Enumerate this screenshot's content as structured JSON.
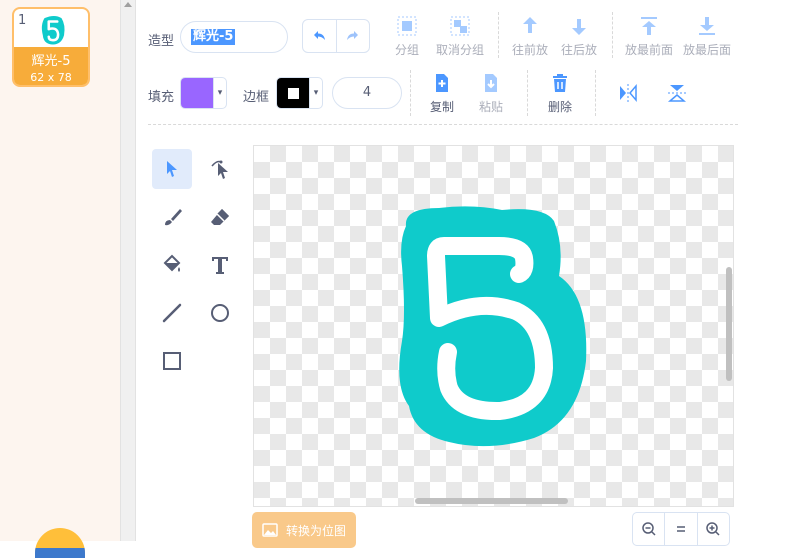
{
  "costume": {
    "number": "1",
    "name": "辉光-5",
    "size": "62 x 78"
  },
  "toolbar": {
    "costume_label": "造型",
    "costume_name": "辉光-5",
    "group": "分组",
    "ungroup": "取消分组",
    "forward": "往前放",
    "backward": "往后放",
    "front": "放最前面",
    "back": "放最后面",
    "fill_label": "填充",
    "outline_label": "边框",
    "outline_width": "4",
    "copy": "复制",
    "paste": "粘贴",
    "delete": "删除"
  },
  "colors": {
    "fill": "#9966ff",
    "outline": "#000000",
    "accent": "#4c97ff",
    "costume_color": "#0fcbcb"
  },
  "bottom": {
    "convert_bitmap": "转换为位图"
  }
}
